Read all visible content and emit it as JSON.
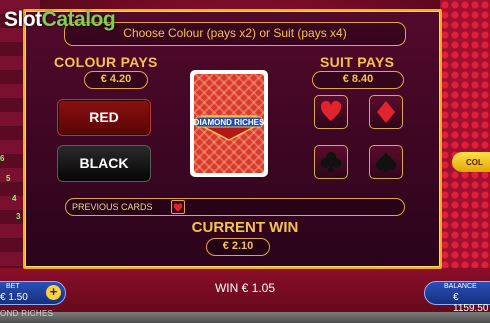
{
  "watermark": {
    "brand_slot": "Slot",
    "brand_catalog": "Catalog"
  },
  "gamble": {
    "instruction": "Choose Colour (pays x2) or Suit (pays x4)",
    "colour_pays_label": "COLOUR PAYS",
    "colour_pays_value": "€ 4.20",
    "suit_pays_label": "SUIT PAYS",
    "suit_pays_value": "€ 8.40",
    "red_label": "RED",
    "black_label": "BLACK",
    "card_back_brand": "DIAMOND RICHES",
    "suits": [
      "hearts",
      "diamonds",
      "clubs",
      "spades"
    ],
    "previous_cards_label": "PREVIOUS CARDS",
    "previous_cards": [
      "hearts"
    ],
    "current_win_label": "CURRENT WIN",
    "current_win_value": "€ 2.10"
  },
  "footer": {
    "bet_label": "BET",
    "bet_value": "€ 1.50",
    "plus_symbol": "+",
    "win_text": "WIN € 1.05",
    "balance_label": "BALANCE",
    "balance_value": "€ 1159.50",
    "game_name": "OND RICHES",
    "side_button_label": "COL"
  },
  "background": {
    "reel_numbers": [
      "6",
      "5",
      "4",
      "3"
    ]
  },
  "colors": {
    "accent_gold": "#f4c44a",
    "frame_gold": "#f2b018",
    "panel_bg": "#3c0622",
    "red_button": "#8a1010",
    "suit_red": "#e0242c"
  }
}
